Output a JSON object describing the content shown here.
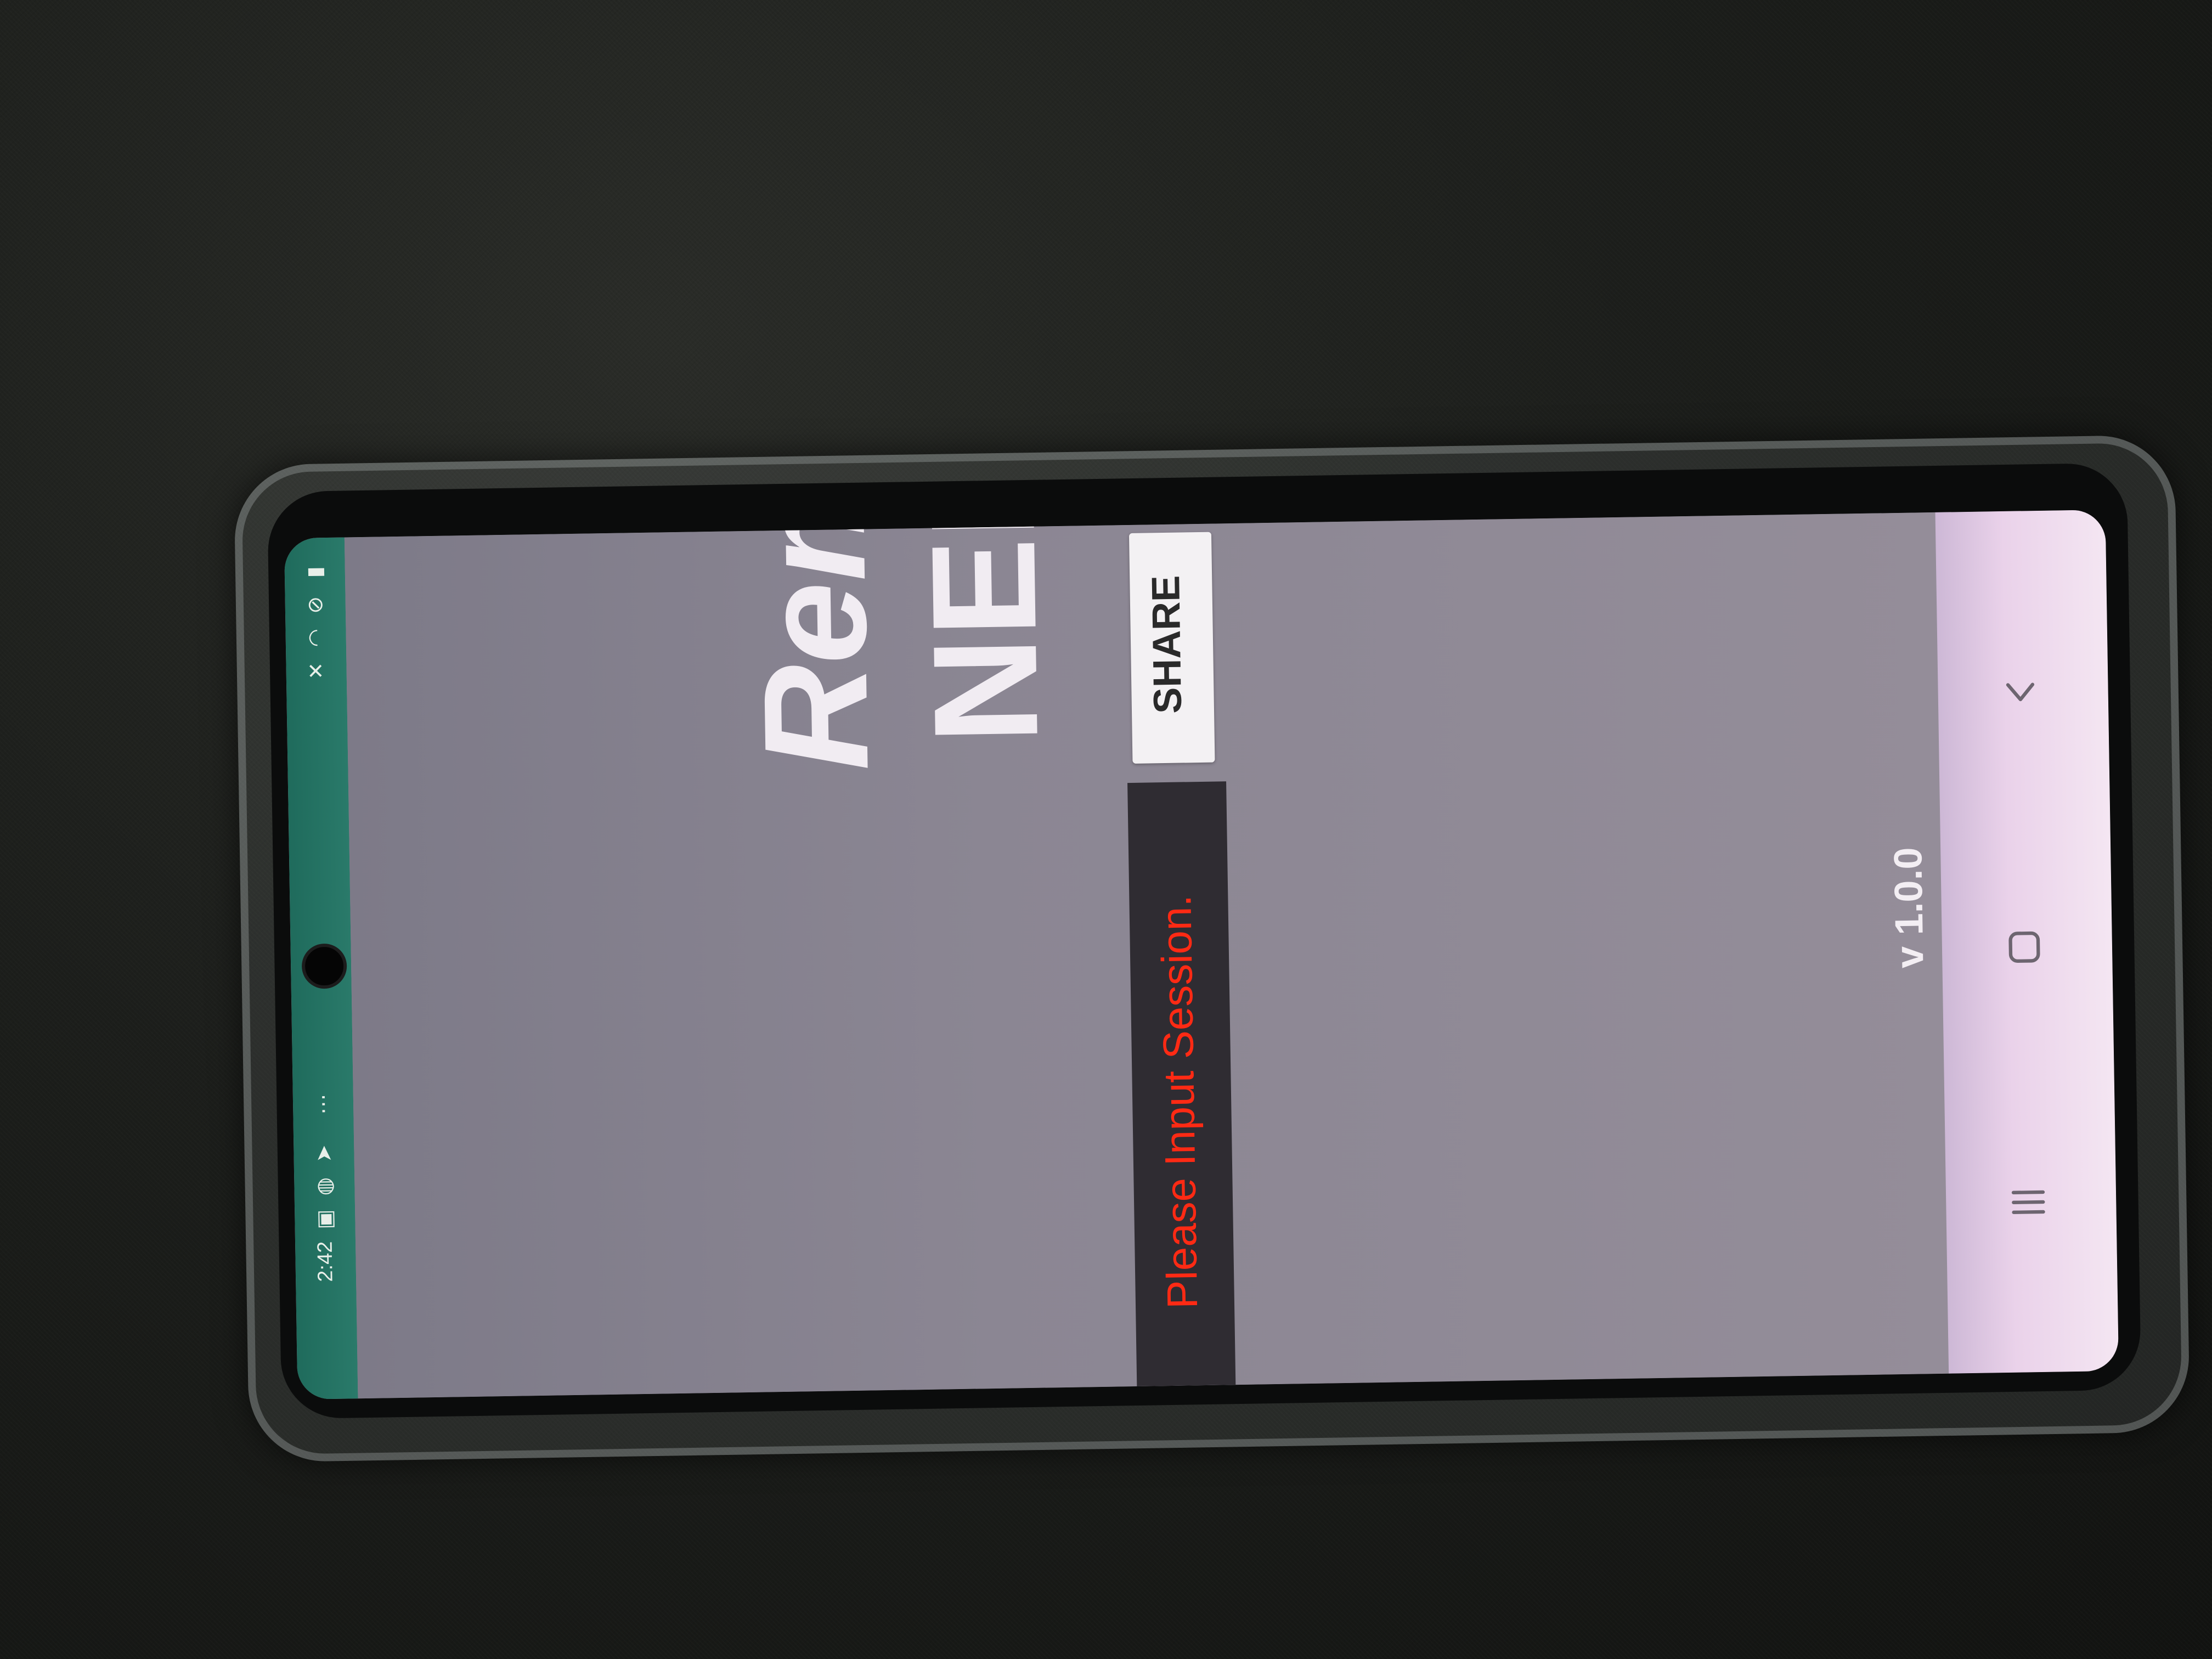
{
  "status_bar": {
    "time": "2:42",
    "icons": [
      "gallery-icon",
      "cast-icon",
      "navigation-icon",
      "more-dots-icon",
      "mute-icon",
      "wifi-icon",
      "do-not-disturb-icon",
      "battery-icon"
    ]
  },
  "app": {
    "title_line1": "Remote",
    "title_line2": "NEMO",
    "share_label": "SHARE",
    "session_placeholder": "Please Input Session.",
    "version": "v 1.0.0"
  },
  "nav_bar": {
    "icons": [
      "back-icon",
      "home-icon",
      "recents-icon"
    ]
  },
  "colors": {
    "status_bar": "#1f6b5c",
    "screen_bg": "#8b8693",
    "placeholder_text": "#ff2a14",
    "input_bg": "#2f2c32",
    "title_text": "#f1ecf2"
  }
}
